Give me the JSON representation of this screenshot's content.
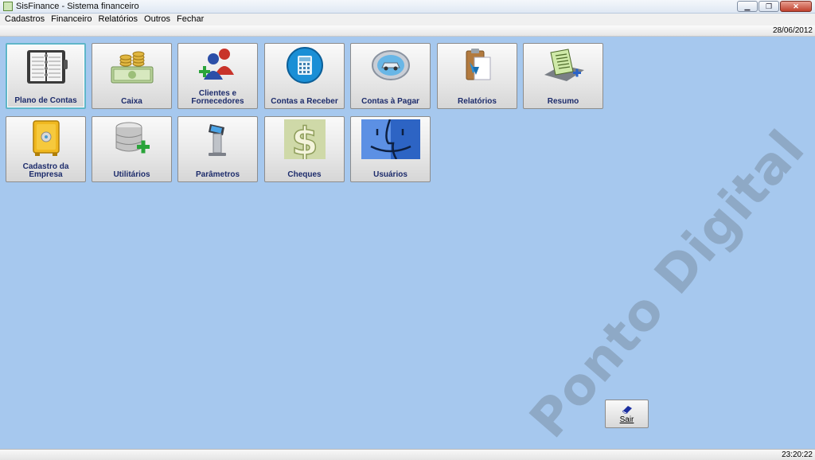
{
  "window": {
    "title": "SisFinance - Sistema financeiro",
    "minimize": "▁",
    "maximize": "❐",
    "close": "✕"
  },
  "menu": [
    "Cadastros",
    "Financeiro",
    "Relatórios",
    "Outros",
    "Fechar"
  ],
  "date": "28/06/2012",
  "tiles": [
    {
      "label": "Plano de Contas",
      "icon": "planner-book-icon",
      "selected": true
    },
    {
      "label": "Caixa",
      "icon": "cash-money-icon"
    },
    {
      "label": "Clientes e Fornecedores",
      "icon": "users-add-icon"
    },
    {
      "label": "Contas a Receber",
      "icon": "calculator-icon"
    },
    {
      "label": "Contas à Pagar",
      "icon": "car-badge-icon"
    },
    {
      "label": "Relatórios",
      "icon": "clipboard-report-icon"
    },
    {
      "label": "Resumo",
      "icon": "document-summary-icon"
    },
    {
      "label": "Cadastro da Empresa",
      "icon": "safe-icon"
    },
    {
      "label": "Utilitários",
      "icon": "database-add-icon"
    },
    {
      "label": "Parâmetros",
      "icon": "kiosk-terminal-icon"
    },
    {
      "label": "Cheques",
      "icon": "dollar-sign-icon"
    },
    {
      "label": "Usuários",
      "icon": "finder-face-icon"
    }
  ],
  "watermark": "Ponto Digital",
  "exit_button": {
    "label": "Sair",
    "icon": "eraser-icon"
  },
  "clock": "23:20:22",
  "colors": {
    "desktop": "#a6c8ee",
    "label": "#1c2b6b",
    "selected_border": "#5fb6c8"
  }
}
